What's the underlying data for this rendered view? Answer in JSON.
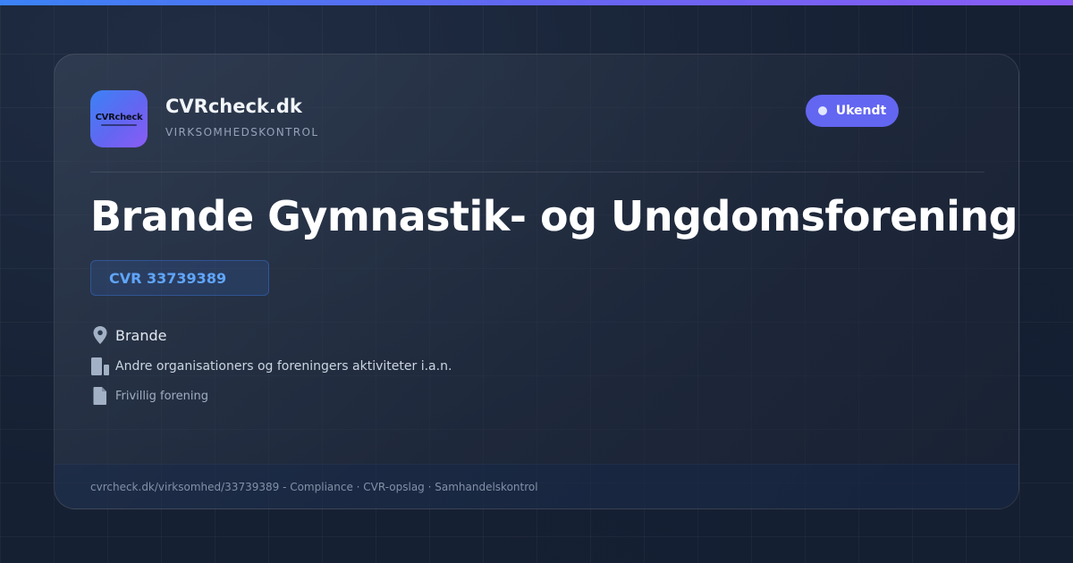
{
  "brand": {
    "logo_text": "CVRcheck",
    "name": "CVRcheck.dk",
    "tagline": "VIRKSOMHEDSKONTROL"
  },
  "status": {
    "label": "Ukendt"
  },
  "company": {
    "name": "Brande Gymnastik- og Ungdomsforening",
    "cvr": "CVR 33739389",
    "location": "Brande",
    "industry": "Andre organisationers og foreningers aktiviteter i.a.n.",
    "type": "Frivillig forening"
  },
  "icons": {
    "location": "map-pin-icon",
    "industry": "building-icon",
    "type": "document-icon"
  },
  "footer": {
    "text": "cvrcheck.dk/virksomhed/33739389 - Compliance · CVR-opslag · Samhandelskontrol"
  },
  "colors": {
    "accent_start": "#3b82f6",
    "accent_mid": "#6366f1",
    "accent_end": "#8b5cf6",
    "status_badge": "#6366f1",
    "cvr_text": "#60a5fa"
  }
}
